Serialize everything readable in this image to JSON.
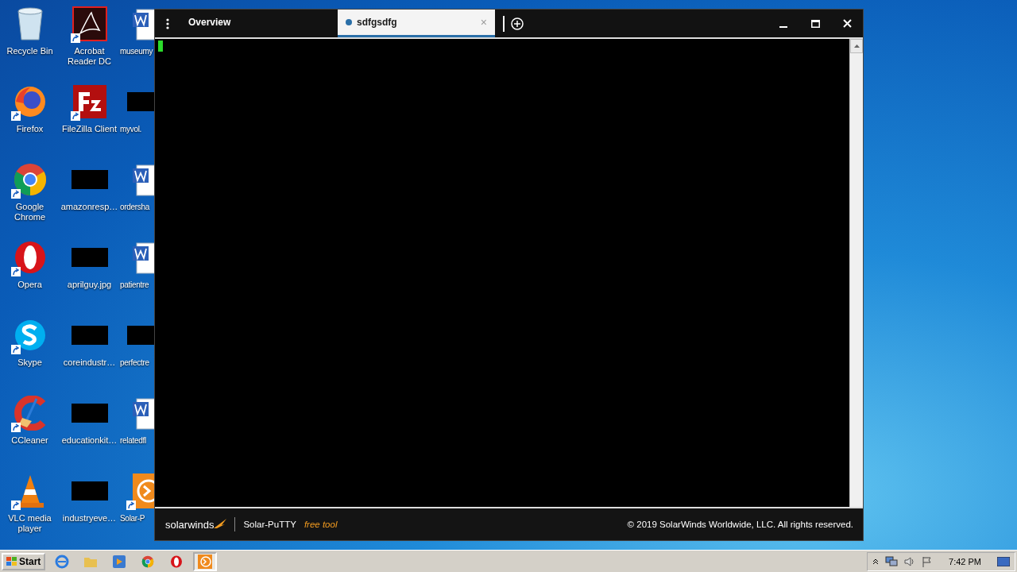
{
  "desktop": {
    "icons": [
      {
        "label": "Recycle Bin",
        "kind": "recycle",
        "shortcut": false
      },
      {
        "label": "Firefox",
        "kind": "firefox",
        "shortcut": true
      },
      {
        "label": "Google Chrome",
        "kind": "chrome",
        "shortcut": true
      },
      {
        "label": "Opera",
        "kind": "opera",
        "shortcut": true
      },
      {
        "label": "Skype",
        "kind": "skype",
        "shortcut": true
      },
      {
        "label": "CCleaner",
        "kind": "ccleaner",
        "shortcut": true
      },
      {
        "label": "VLC media player",
        "kind": "vlc",
        "shortcut": true
      },
      {
        "label": "Acrobat Reader DC",
        "kind": "acrobat",
        "shortcut": true
      },
      {
        "label": "FileZilla Client",
        "kind": "filezilla",
        "shortcut": true
      },
      {
        "label": "amazonresp…",
        "kind": "thumbnail",
        "shortcut": false
      },
      {
        "label": "aprilguy.jpg",
        "kind": "thumbnail",
        "shortcut": false
      },
      {
        "label": "coreindustr…",
        "kind": "thumbnail",
        "shortcut": false
      },
      {
        "label": "educationkit…",
        "kind": "thumbnail",
        "shortcut": false
      },
      {
        "label": "industryeve…",
        "kind": "thumbnail",
        "shortcut": false
      },
      {
        "label": "museumy",
        "kind": "word",
        "shortcut": false
      },
      {
        "label": "myvol.",
        "kind": "thumbnail",
        "shortcut": false
      },
      {
        "label": "ordersha",
        "kind": "word",
        "shortcut": false
      },
      {
        "label": "patientre",
        "kind": "word",
        "shortcut": false
      },
      {
        "label": "perfectre",
        "kind": "thumbnail",
        "shortcut": false
      },
      {
        "label": "relatedfl",
        "kind": "word",
        "shortcut": false
      },
      {
        "label": "Solar-P",
        "kind": "solar",
        "shortcut": true
      }
    ]
  },
  "window": {
    "tabs": [
      {
        "label": "Overview",
        "selected": false
      },
      {
        "label": "sdfgsdfg",
        "selected": true
      }
    ],
    "close_tab": "×"
  },
  "footer": {
    "brand": "solarwinds",
    "product": "Solar-PuTTY",
    "tag": "free tool",
    "copyright": "© 2019 SolarWinds Worldwide, LLC. All rights reserved."
  },
  "taskbar": {
    "start": "Start",
    "apps": [
      {
        "kind": "ie",
        "selected": false
      },
      {
        "kind": "folder",
        "selected": false
      },
      {
        "kind": "media",
        "selected": false
      },
      {
        "kind": "chrome",
        "selected": false
      },
      {
        "kind": "opera",
        "selected": false
      },
      {
        "kind": "solar",
        "selected": true
      }
    ],
    "time": "7:42 PM"
  }
}
